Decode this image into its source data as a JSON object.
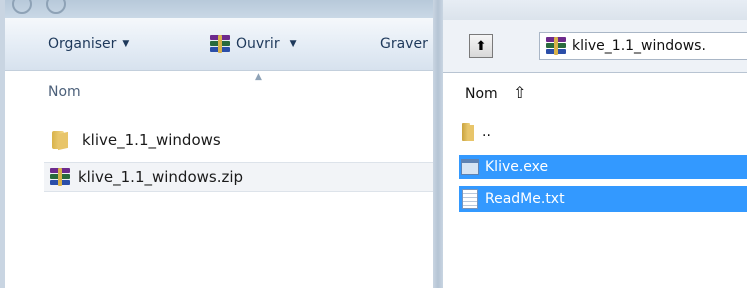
{
  "explorer": {
    "toolbar": {
      "organize_label": "Organiser",
      "open_label": "Ouvrir",
      "burn_label": "Graver"
    },
    "columns": {
      "name": "Nom"
    },
    "files": [
      {
        "name": "klive_1.1_windows",
        "icon": "folder-icon",
        "selected": false
      },
      {
        "name": "klive_1.1_windows.zip",
        "icon": "winrar-archive-icon",
        "selected": true
      }
    ]
  },
  "winrar": {
    "address": "klive_1.1_windows.",
    "columns": {
      "name": "Nom",
      "sort_icon": "up-arrow-icon"
    },
    "files": [
      {
        "name": "..",
        "icon": "folder-icon",
        "selected": false
      },
      {
        "name": "Klive.exe",
        "icon": "exe-icon",
        "selected": true
      },
      {
        "name": "ReadMe.txt",
        "icon": "text-file-icon",
        "selected": true
      }
    ]
  },
  "colors": {
    "selection": "#3399ff",
    "toolbar_text": "#1e395b",
    "folder": "#e8c56a"
  }
}
